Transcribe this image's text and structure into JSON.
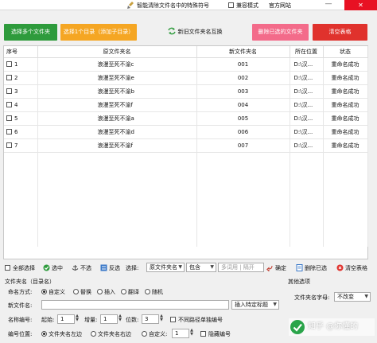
{
  "window": {
    "title": "智能清除文件名中的特殊符号",
    "compat_label": "兼容模式",
    "site_label": "官方网站",
    "min_glyph": "—",
    "close_glyph": "✕"
  },
  "topbar": {
    "select_files": "选择多个文件夹",
    "select_dir": "选择1个目录（添加子目录）",
    "swap_names": "新旧文件夹名互换",
    "delete_selected": "删除已选的文件夹",
    "clear_table": "清空表格"
  },
  "table": {
    "columns": [
      "序号",
      "原文件夹名",
      "新文件夹名",
      "所在位置",
      "状态"
    ],
    "rows": [
      {
        "no": "1",
        "orig": "浪漫至死不渝c",
        "new": "001",
        "loc": "D:\\汉...",
        "status": "重命名成功"
      },
      {
        "no": "2",
        "orig": "浪漫至死不渝e",
        "new": "002",
        "loc": "D:\\汉...",
        "status": "重命名成功"
      },
      {
        "no": "3",
        "orig": "浪漫至死不渝b",
        "new": "003",
        "loc": "D:\\汉...",
        "status": "重命名成功"
      },
      {
        "no": "4",
        "orig": "浪漫至死不渝f",
        "new": "004",
        "loc": "D:\\汉...",
        "status": "重命名成功"
      },
      {
        "no": "5",
        "orig": "浪漫至死不渝a",
        "new": "005",
        "loc": "D:\\汉...",
        "status": "重命名成功"
      },
      {
        "no": "6",
        "orig": "浪漫至死不渝d",
        "new": "006",
        "loc": "D:\\汉...",
        "status": "重命名成功"
      },
      {
        "no": "7",
        "orig": "浪漫至死不渝f",
        "new": "007",
        "loc": "D:\\汉...",
        "status": "重命名成功"
      }
    ]
  },
  "toolbar": {
    "select_all": "全部选择",
    "select": "选中",
    "deselect": "不选",
    "invert": "反选",
    "filter_label": "选择:",
    "filter_field": "原文件夹名",
    "filter_mode": "包含",
    "filter_placeholder": "多词用 | 隔开",
    "confirm": "确定",
    "delete_selected": "删除已选",
    "clear_table": "清空表格"
  },
  "rename": {
    "group_label": "文件夹名（目录名）",
    "mode_label": "命名方式:",
    "modes": [
      "自定义",
      "替换",
      "插入",
      "翻译",
      "随机"
    ],
    "new_name_label": "新文件名:",
    "new_name_value": "",
    "insert_special": "插入特定标题",
    "number_label": "名称编号:",
    "start_label": "起始:",
    "start_value": "1",
    "step_label": "增量:",
    "step_value": "1",
    "digits_label": "位数:",
    "digits_value": "3",
    "per_path_label": "不同路径单独编号",
    "pos_label": "编号位置:",
    "positions": [
      "文件夹名左边",
      "文件夹名右边",
      "自定义:"
    ],
    "custom_value": "1",
    "hide_number_label": "隐藏编号"
  },
  "other": {
    "group_label": "其他选项",
    "case_label": "文件夹名字母:",
    "case_value": "不改变"
  },
  "watermark": {
    "text": "知乎 @你懂的"
  }
}
